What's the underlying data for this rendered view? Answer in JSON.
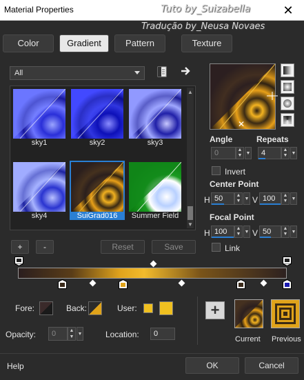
{
  "window": {
    "title": "Material Properties",
    "close_glyph": "✕"
  },
  "watermark": {
    "line1": "Tuto by_Suizabella",
    "line2": "Tradução by_Neusa Novaes"
  },
  "tabs": [
    {
      "label": "Color"
    },
    {
      "label": "Gradient"
    },
    {
      "label": "Pattern"
    },
    {
      "label": "Texture"
    }
  ],
  "category": {
    "selected": "All"
  },
  "gradients": [
    {
      "label": "sky1"
    },
    {
      "label": "sky2"
    },
    {
      "label": "sky3"
    },
    {
      "label": "sky4"
    },
    {
      "label": "SuiGrad016"
    },
    {
      "label": "Summer Field"
    }
  ],
  "list_buttons": {
    "add": "+",
    "remove": "-",
    "reset": "Reset",
    "save": "Save"
  },
  "angle": {
    "label": "Angle",
    "value": "0"
  },
  "repeats": {
    "label": "Repeats",
    "value": "4"
  },
  "invert": {
    "label": "Invert"
  },
  "center_point": {
    "label": "Center Point",
    "h_label": "H",
    "h_value": "50",
    "v_label": "V",
    "v_value": "100"
  },
  "focal_point": {
    "label": "Focal Point",
    "h_label": "H",
    "h_value": "100",
    "v_label": "V",
    "v_value": "50"
  },
  "link": {
    "label": "Link"
  },
  "bottom": {
    "fore_label": "Fore:",
    "back_label": "Back:",
    "user_label": "User:",
    "opacity_label": "Opacity:",
    "opacity_value": "0",
    "location_label": "Location:",
    "location_value": "0",
    "add_glyph": "+",
    "current_label": "Current",
    "previous_label": "Previous"
  },
  "footer": {
    "help": "Help",
    "ok": "OK",
    "cancel": "Cancel"
  },
  "colors": {
    "accent": "#2a7fd4",
    "gold": "#e0a31a",
    "dark_brown": "#3a2a1a",
    "user_yellow": "#f0c020"
  }
}
